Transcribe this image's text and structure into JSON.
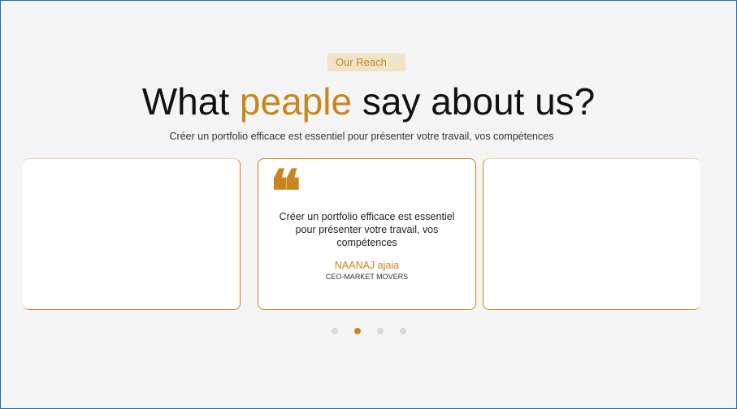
{
  "section": {
    "badge": "Our Reach",
    "title_before": "What ",
    "title_accent": "peaple",
    "title_after": " say about us?",
    "subtitle": "Créer un portfolio efficace est essentiel pour présenter votre travail, vos compétences"
  },
  "testimonial": {
    "quote_glyph": "❝",
    "text": "Créer un portfolio efficace est essentiel pour présenter votre travail, vos compétences",
    "author": "NAANAJ ajaia",
    "role": "CEO-MARKET MOVERS"
  },
  "carousel": {
    "slide_count": 4,
    "active_index": 1
  },
  "colors": {
    "accent": "#c8861e",
    "badge_bg": "#efe3c8",
    "background": "#f5f5f5"
  }
}
